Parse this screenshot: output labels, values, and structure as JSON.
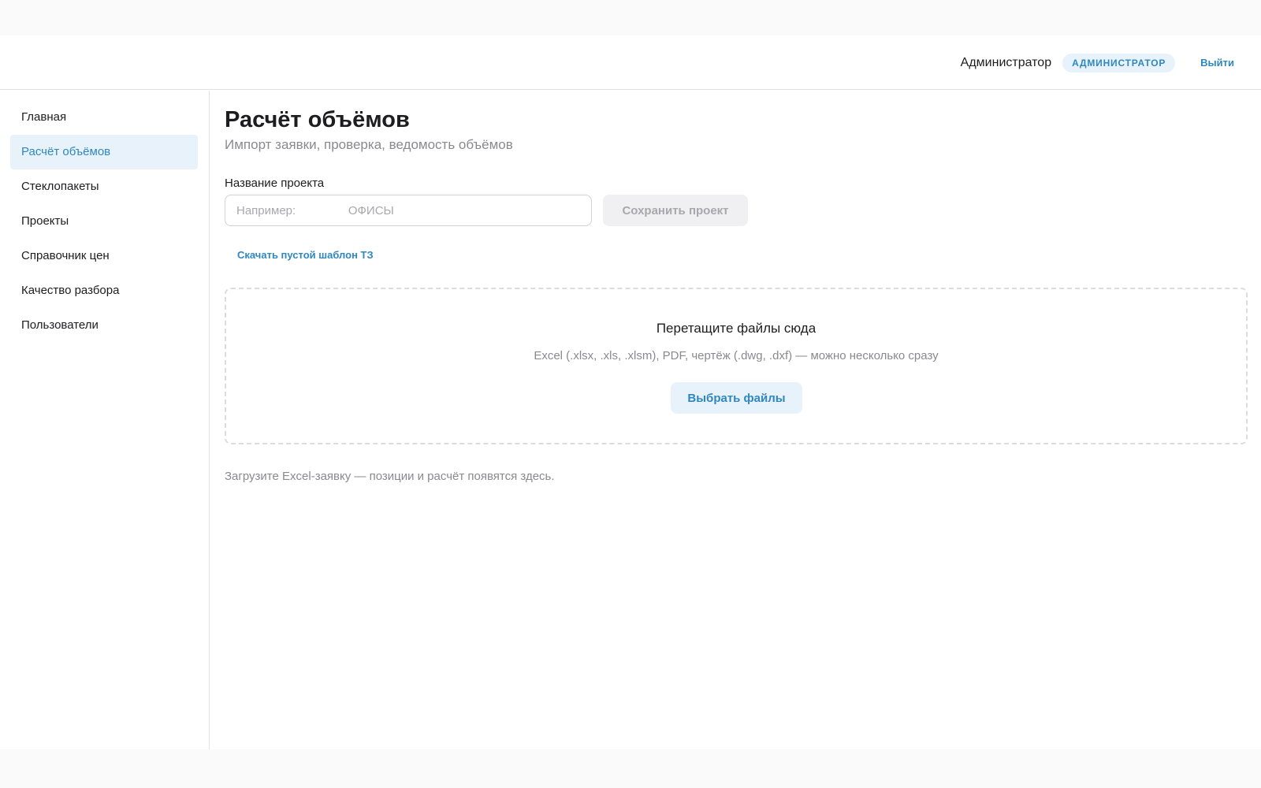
{
  "header": {
    "user_name": "Администратор",
    "role_badge": "АДМИНИСТРАТОР",
    "logout": "Выйти"
  },
  "sidebar": {
    "items": [
      {
        "label": "Главная",
        "active": false
      },
      {
        "label": "Расчёт объёмов",
        "active": true
      },
      {
        "label": "Стеклопакеты",
        "active": false
      },
      {
        "label": "Проекты",
        "active": false
      },
      {
        "label": "Справочник цен",
        "active": false
      },
      {
        "label": "Качество разбора",
        "active": false
      },
      {
        "label": "Пользователи",
        "active": false
      }
    ]
  },
  "main": {
    "title": "Расчёт объёмов",
    "subtitle": "Импорт заявки, проверка, ведомость объёмов",
    "project_field": {
      "label": "Название проекта",
      "value": "",
      "placeholder": "Например:                ОФИСЫ"
    },
    "save_button": "Сохранить проект",
    "template_link": "Скачать пустой шаблон ТЗ",
    "dropzone": {
      "title": "Перетащите файлы сюда",
      "hint": "Excel (.xlsx, .xls, .xlsm), PDF, чертёж (.dwg, .dxf) — можно несколько сразу",
      "button": "Выбрать файлы"
    },
    "empty_hint": "Загрузите Excel-заявку — позиции и расчёт появятся здесь."
  },
  "colors": {
    "accent": "#2f87c0",
    "accent_bg": "#e8f2fb",
    "muted_text": "#8a8a8e",
    "border": "#e2e2e6"
  }
}
